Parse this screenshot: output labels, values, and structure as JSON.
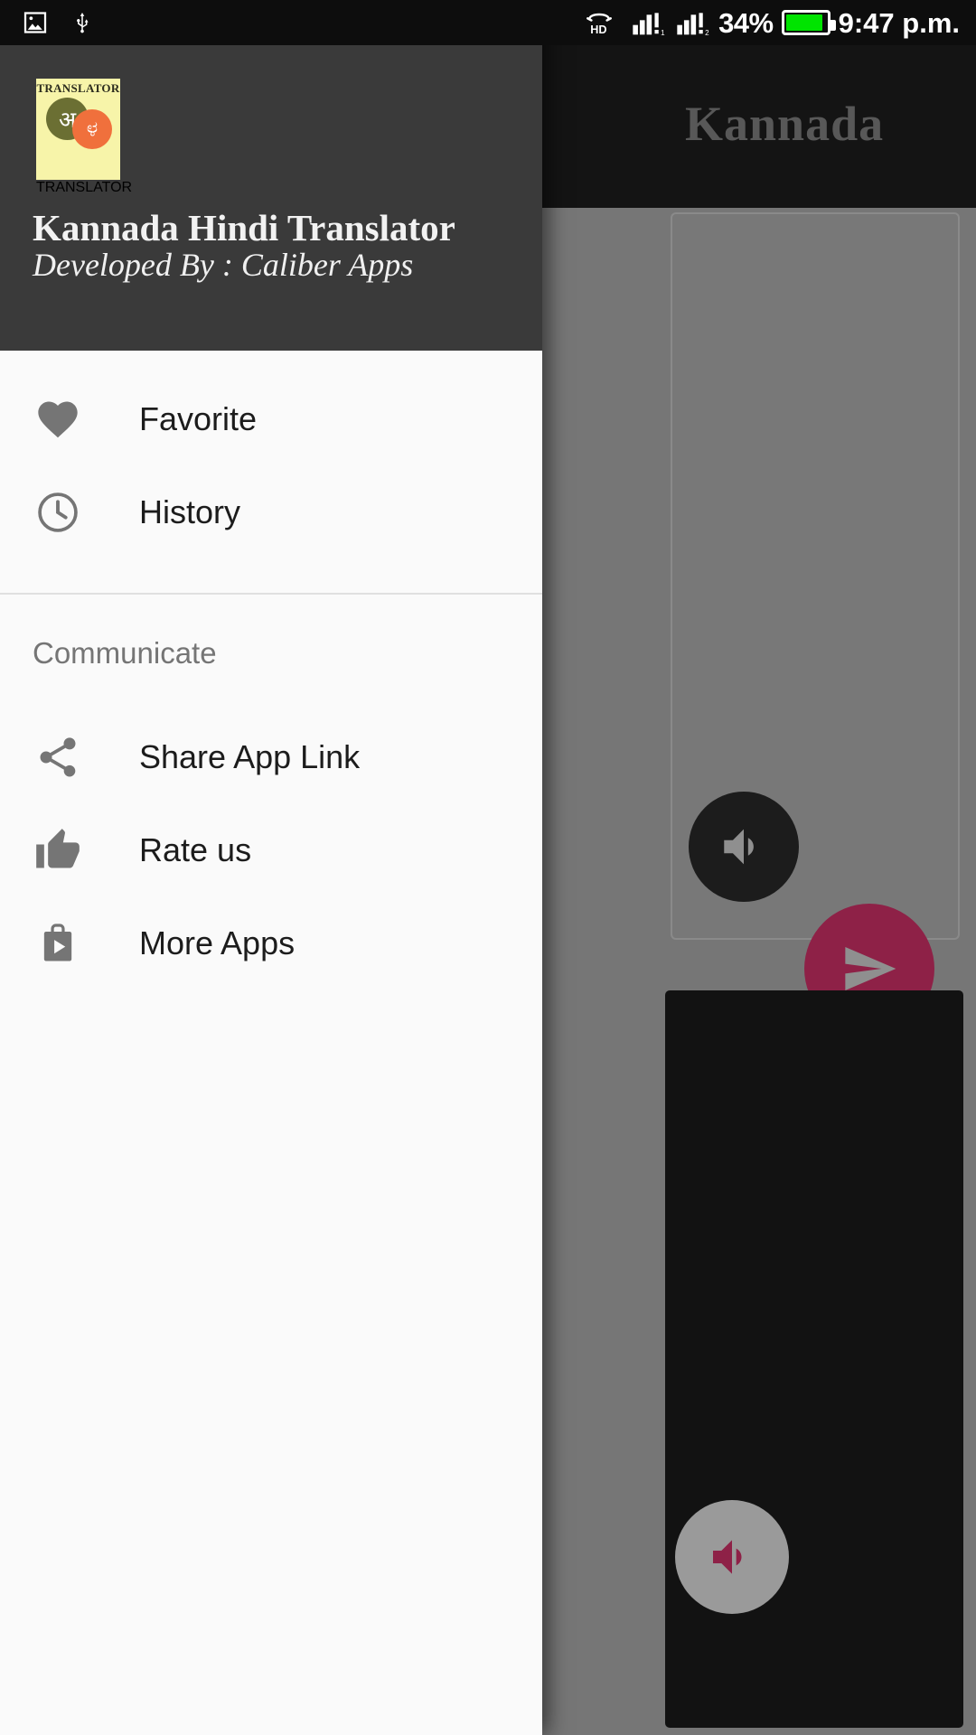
{
  "status_bar": {
    "icons": [
      "image-icon",
      "usb-icon"
    ],
    "network_label": "HD",
    "sim1_signal": "signal-bars-alert",
    "sim2_signal": "signal-bars-alert",
    "battery_percent": "34%",
    "battery_level": 34,
    "battery_color": "#00e400",
    "time": "9:47 p.m."
  },
  "drawer": {
    "logo": {
      "top_text": "TRANSLATOR",
      "hindi_char": "अ",
      "kannada_char": "ಳ",
      "bottom_text": "TRANSLATOR",
      "bg_color": "#f7f4a9",
      "hindi_circle_color": "#6b6f33",
      "kannada_circle_color": "#f0703c"
    },
    "title": "Kannada Hindi Translator",
    "subtitle": "Developed By : Caliber Apps",
    "header_bg": "#3a3a3a",
    "items": [
      {
        "label": "Favorite",
        "icon": "heart-icon"
      },
      {
        "label": "History",
        "icon": "clock-icon"
      }
    ],
    "section_label": "Communicate",
    "communicate_items": [
      {
        "label": "Share App Link",
        "icon": "share-icon"
      },
      {
        "label": "Rate us",
        "icon": "thumb-up-icon"
      },
      {
        "label": "More Apps",
        "icon": "play-store-bag-icon"
      }
    ]
  },
  "background_app": {
    "appbar_title": "Kannada",
    "speak_button_top": "volume-up-icon",
    "send_button": "send-icon",
    "speak_button_bottom": "volume-up-icon",
    "accent_color": "#8e2147"
  }
}
